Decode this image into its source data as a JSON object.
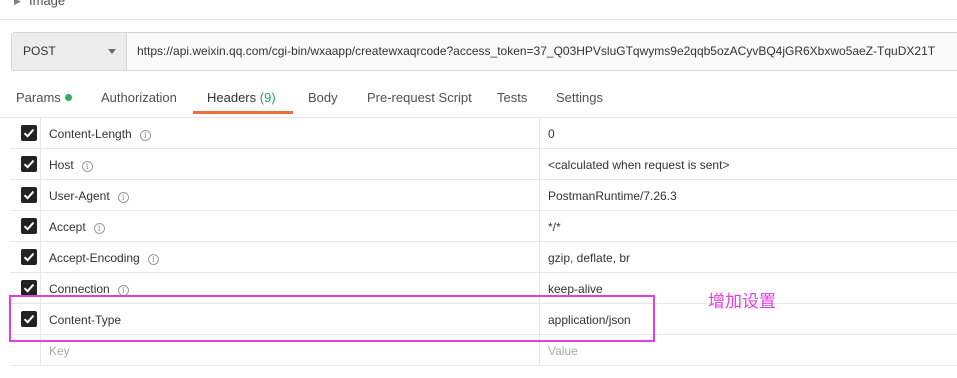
{
  "section": {
    "label": "Image"
  },
  "request": {
    "method": "POST",
    "url": "https://api.weixin.qq.com/cgi-bin/wxaapp/createwxaqrcode?access_token=37_Q03HPVsluGTqwyms9e2qqb5ozACyvBQ4jGR6Xbxwo5aeZ-TquDX21T"
  },
  "tabs": [
    {
      "label": "Params",
      "dot": true
    },
    {
      "label": "Authorization"
    },
    {
      "label": "Headers",
      "count": "(9)",
      "active": true
    },
    {
      "label": "Body"
    },
    {
      "label": "Pre-request Script"
    },
    {
      "label": "Tests"
    },
    {
      "label": "Settings"
    }
  ],
  "headers": [
    {
      "key": "Content-Length",
      "value": "0",
      "info": true,
      "checked": true
    },
    {
      "key": "Host",
      "value": "<calculated when request is sent>",
      "info": true,
      "checked": true
    },
    {
      "key": "User-Agent",
      "value": "PostmanRuntime/7.26.3",
      "info": true,
      "checked": true
    },
    {
      "key": "Accept",
      "value": "*/*",
      "info": true,
      "checked": true
    },
    {
      "key": "Accept-Encoding",
      "value": "gzip, deflate, br",
      "info": true,
      "checked": true
    },
    {
      "key": "Connection",
      "value": "keep-alive",
      "info": true,
      "checked": true
    },
    {
      "key": "Content-Type",
      "value": "application/json",
      "info": false,
      "checked": true
    }
  ],
  "new_row": {
    "key_placeholder": "Key",
    "value_placeholder": "Value"
  },
  "annotation": {
    "text": "增加设置",
    "color": "#e040e0"
  },
  "colors": {
    "active_tab": "#f26b3a",
    "params_dot": "#26b35a",
    "headers_count": "#26a269"
  }
}
